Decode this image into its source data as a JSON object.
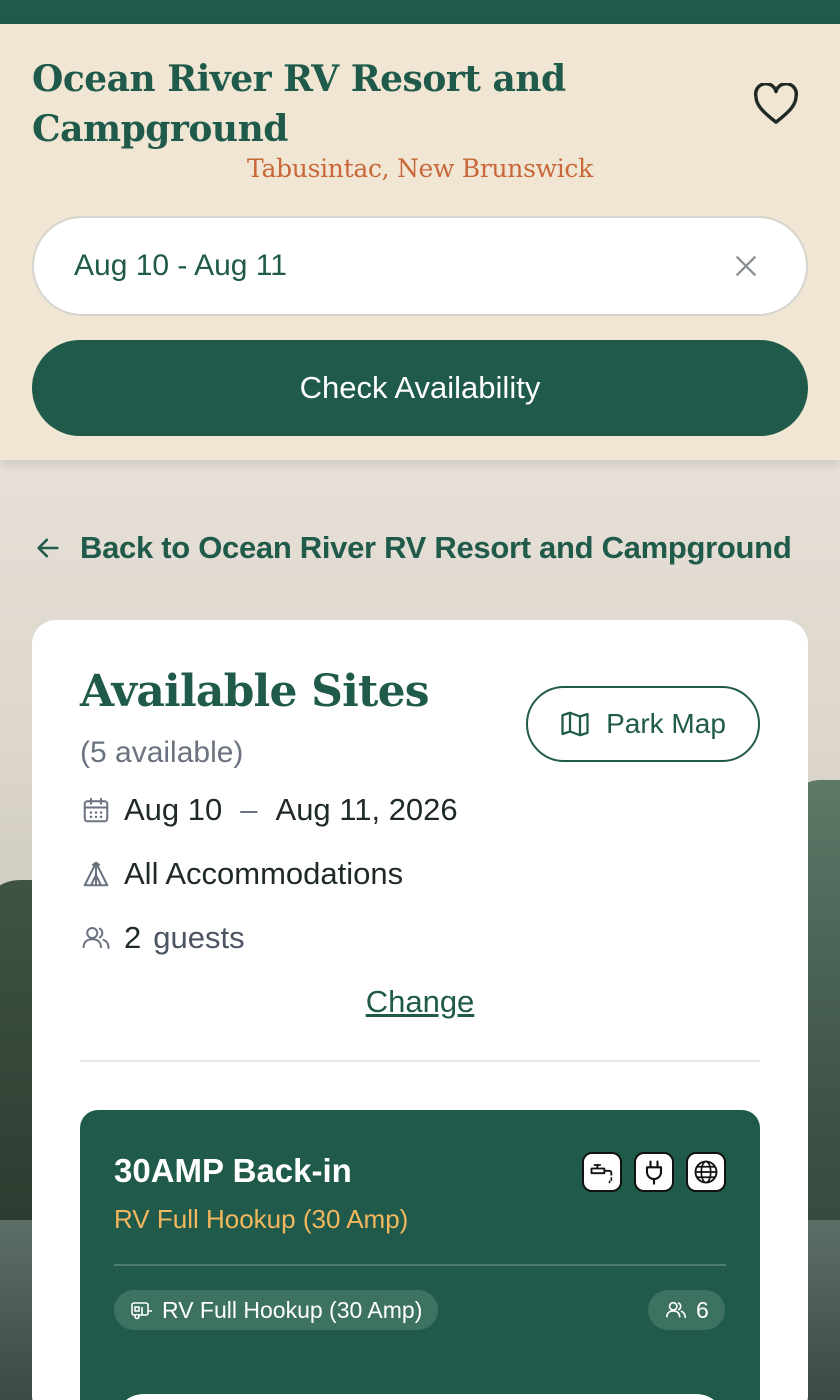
{
  "header": {
    "park_title": "Ocean River RV Resort and Campground",
    "park_location": "Tabusintac, New Brunswick",
    "favorite_icon": "heart-outline-icon",
    "date_range_value": "Aug 10 - Aug 11",
    "clear_icon": "close-icon",
    "check_availability_label": "Check Availability"
  },
  "back_link": {
    "icon": "arrow-left-icon",
    "label": "Back to Ocean River RV Resort and Campground"
  },
  "sites_panel": {
    "title": "Available Sites",
    "count_text": "(5 available)",
    "park_map_label": "Park Map",
    "park_map_icon": "map-icon",
    "dates": {
      "icon": "calendar-icon",
      "start": "Aug 10",
      "separator": "–",
      "end": "Aug 11, 2026"
    },
    "accommodation": {
      "icon": "tent-icon",
      "label": "All Accommodations"
    },
    "guests": {
      "icon": "users-icon",
      "count": "2",
      "label": "guests"
    },
    "change_label": "Change"
  },
  "site_card": {
    "name": "30AMP Back-in",
    "type": "RV Full Hookup (30 Amp)",
    "amenities": [
      "water-faucet-icon",
      "power-plug-icon",
      "wifi-globe-icon"
    ],
    "hookup_pill": "RV Full Hookup (30 Amp)",
    "capacity": "6"
  },
  "colors": {
    "brand_green": "#1f5a4a",
    "header_bg": "#f0e6d3",
    "location_orange": "#c8683a",
    "site_type_gold": "#f3b75e"
  }
}
